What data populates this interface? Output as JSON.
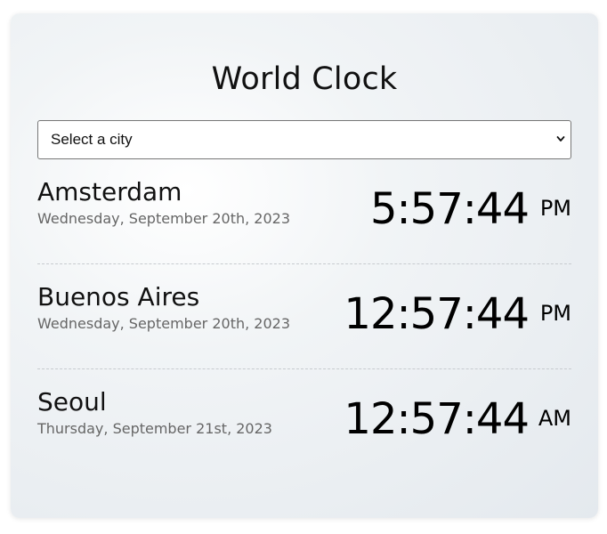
{
  "app": {
    "title": "World Clock"
  },
  "city_select": {
    "value": "Select a city"
  },
  "clocks": [
    {
      "city": "Amsterdam",
      "date": "Wednesday, September 20th, 2023",
      "time": "5:57:44",
      "period": "PM"
    },
    {
      "city": "Buenos Aires",
      "date": "Wednesday, September 20th, 2023",
      "time": "12:57:44",
      "period": "PM"
    },
    {
      "city": "Seoul",
      "date": "Thursday, September 21st, 2023",
      "time": "12:57:44",
      "period": "AM"
    }
  ]
}
